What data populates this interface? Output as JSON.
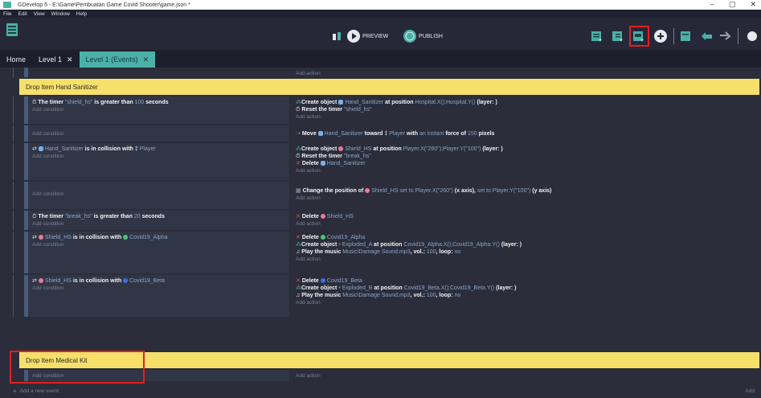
{
  "window": {
    "title": "GDevelop 5 - E:\\Game\\Pembuatan Game Covid Shooter\\game.json *",
    "controls": [
      "–",
      "▢",
      "✕"
    ]
  },
  "menu": [
    "File",
    "Edit",
    "View",
    "Window",
    "Help"
  ],
  "toolbar": {
    "preview": "PREVIEW",
    "publish": "PUBLISH"
  },
  "tabs": [
    {
      "label": "Home"
    },
    {
      "label": "Level 1",
      "close": "✕"
    },
    {
      "label": "Level 1 (Events)",
      "close": "✕"
    }
  ],
  "events": {
    "add_action": "Add action",
    "add_condition": "Add condition",
    "add_new_event": "Add a new event",
    "add_trailing": "Add",
    "group1": "Drop Item Hand Sanitizer",
    "group2": "Drop Item Medical Kit",
    "c1": "The timer",
    "c1_t": "\"shield_hs\"",
    "c1_m": "is greater than",
    "c1_n": "100",
    "c1_s": "seconds",
    "a1a": "Create object",
    "a1a_o": "Hand_Sanitizer",
    "a1a_m": "at position",
    "a1a_p": "Hospital.X();Hospital.Y()",
    "a1a_l": "(layer: )",
    "a1b": "Reset the timer",
    "a1b_t": "\"shield_hs\"",
    "a2": "Move",
    "a2_o": "Hand_Sanitizer",
    "a2_m": "toward",
    "a2_p": "Player",
    "a2_w": "with",
    "a2_f": "an instant",
    "a2_f2": "force of",
    "a2_n": "150",
    "a2_u": "pixels",
    "c3_o": "Hand_Sanitizer",
    "c3_m": "is in collision with",
    "c3_p": "Player",
    "a3a": "Create object",
    "a3a_o": "Shield_HS",
    "a3a_m": "at position",
    "a3a_p": "Player.X(\"260\");Player.Y(\"100\")",
    "a3a_l": "(layer: )",
    "a3b": "Reset the timer",
    "a3b_t": "\"break_hs\"",
    "a3c": "Delete",
    "a3c_o": "Hand_Sanitizer",
    "a4": "Change the position of",
    "a4_o": "Shield_HS",
    "a4_m1": "set to",
    "a4_x": "Player.X(\"260\")",
    "a4_xa": "(x axis),",
    "a4_m2": "set to",
    "a4_y": "Player.Y(\"100\")",
    "a4_ya": "(y axis)",
    "c5": "The timer",
    "c5_t": "\"break_hs\"",
    "c5_m": "is greater than",
    "c5_n": "20",
    "c5_s": "seconds",
    "a5": "Delete",
    "a5_o": "Shield_HS",
    "c6_o": "Shield_HS",
    "c6_m": "is in collision with",
    "c6_p": "Covid19_Alpha",
    "a6a": "Delete",
    "a6a_o": "Covid19_Alpha",
    "a6b": "Create object",
    "a6b_o": "Exploded_A",
    "a6b_m": "at position",
    "a6b_p": "Covid19_Alpha.X();Covid19_Alpha.Y()",
    "a6b_l": "(layer: )",
    "a6c": "Play the music",
    "a6c_f": "Music\\Damage Sound.mp3",
    "a6c_v": ", vol.:",
    "a6c_vn": "100",
    "a6c_lp": ", loop:",
    "a6c_lv": "no",
    "c7_o": "Shield_HS",
    "c7_m": "is in collision with",
    "c7_p": "Covid19_Beta",
    "a7a": "Delete",
    "a7a_o": "Covid19_Beta",
    "a7b": "Create object",
    "a7b_o": "Exploded_B",
    "a7b_m": "at position",
    "a7b_p": "Covid19_Beta.X();Covid19_Beta.Y()",
    "a7b_l": "(layer: )",
    "a7c": "Play the music",
    "a7c_f": "Music\\Damage Sound.mp3",
    "a7c_v": ", vol.:",
    "a7c_vn": "100",
    "a7c_lp": ", loop:",
    "a7c_lv": "no"
  },
  "colors": {
    "accent": "#4ab0a8",
    "group": "#f6e06a",
    "highlight": "#e02020"
  }
}
